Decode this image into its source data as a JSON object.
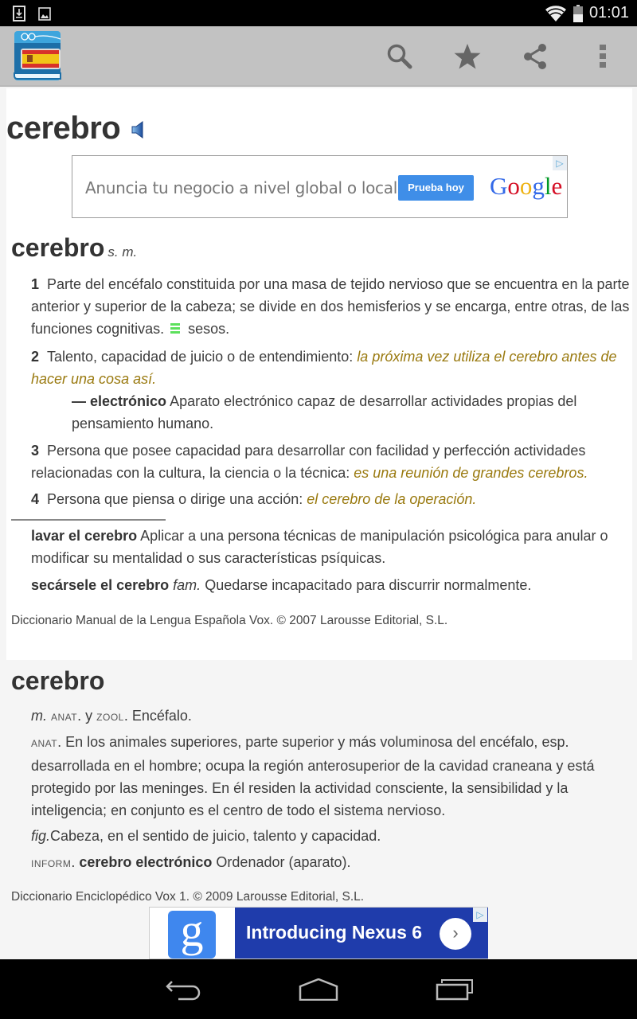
{
  "status_bar": {
    "time": "01:01",
    "icons": [
      "download-notification-icon",
      "image-notification-icon",
      "wifi-icon",
      "battery-icon"
    ]
  },
  "action_bar": {
    "app_icon": "spanish-dictionary-app-icon",
    "actions": [
      {
        "name": "search",
        "icon": "search-icon"
      },
      {
        "name": "favorite",
        "icon": "star-icon"
      },
      {
        "name": "share",
        "icon": "share-icon"
      },
      {
        "name": "overflow",
        "icon": "overflow-menu-icon"
      }
    ]
  },
  "word": {
    "headword": "cerebro",
    "audio_icon": "speaker-icon"
  },
  "ad_top": {
    "text": "Anuncia tu negocio a nivel global o local.",
    "button": "Prueba hoy",
    "brand": "Google",
    "brand_colors": [
      "#3369e8",
      "#d50f25",
      "#eeb211",
      "#3369e8",
      "#009925",
      "#d50f25"
    ]
  },
  "entry1": {
    "headword": "cerebro",
    "pos": "s. m.",
    "senses": [
      {
        "num": "1",
        "text": "Parte del encéfalo constituida por una masa de tejido nervioso que se encuentra en la parte anterior y superior de la cabeza; se divide en dos hemisferios y se encarga, entre otras, de las funciones cognitivas.",
        "synonym": "sesos."
      },
      {
        "num": "2",
        "text": "Talento, capacidad de juicio o de entendimiento:",
        "example": "la próxima vez utiliza el cerebro antes de hacer una cosa así.",
        "subentry": {
          "dash": "—",
          "term": "electrónico",
          "text": "Aparato electrónico capaz de desarrollar actividades propias del pensamiento humano."
        }
      },
      {
        "num": "3",
        "text": "Persona que posee capacidad para desarrollar con facilidad y perfección actividades relacionadas con la cultura, la ciencia o la técnica:",
        "example": "es una reunión de grandes cerebros."
      },
      {
        "num": "4",
        "text": "Persona que piensa o dirige una acción:",
        "example": "el cerebro de la operación."
      }
    ],
    "phrases": [
      {
        "term": "lavar el cerebro",
        "label": "",
        "text": "Aplicar a una persona técnicas de manipulación psicológica para anular o modificar su mentalidad o sus características psíquicas."
      },
      {
        "term": "secársele el cerebro",
        "label": "fam.",
        "text": "Quedarse incapacitado para discurrir normalmente."
      }
    ],
    "source": "Diccionario Manual de la Lengua Española Vox. © 2007 Larousse Editorial, S.L."
  },
  "entry2": {
    "headword": "cerebro",
    "lines": [
      {
        "pos": "m.",
        "label1": "anat",
        "conj": "y",
        "label2": "zool",
        "text": "Encéfalo."
      },
      {
        "label": "anat",
        "text": "En los animales superiores, parte superior y más voluminosa del encéfalo, esp. desarrollada en el hombre; ocupa la región anterosuperior de la cavidad craneana y está protegido por las meninges. En él residen la actividad consciente, la sensibilidad y la inteligencia; en conjunto es el centro de todo el sistema nervioso."
      },
      {
        "label": "fig.",
        "text": "Cabeza, en el sentido de juicio, talento y capacidad."
      },
      {
        "label": "inform",
        "term": "cerebro electrónico",
        "text": "Ordenador (aparato)."
      }
    ],
    "source": "Diccionario Enciclopédico Vox 1. © 2009 Larousse Editorial, S.L."
  },
  "ad_bottom": {
    "logo_letter": "g",
    "text": "Introducing Nexus 6",
    "go": "›",
    "banner_color": "#1f3cab"
  },
  "nav_bar": {
    "buttons": [
      "back-icon",
      "home-icon",
      "recent-apps-icon"
    ]
  },
  "colors": {
    "example_text": "#9a7a10",
    "synonym_icon": "#5ce05c",
    "action_bar": "#c2c2c2"
  }
}
